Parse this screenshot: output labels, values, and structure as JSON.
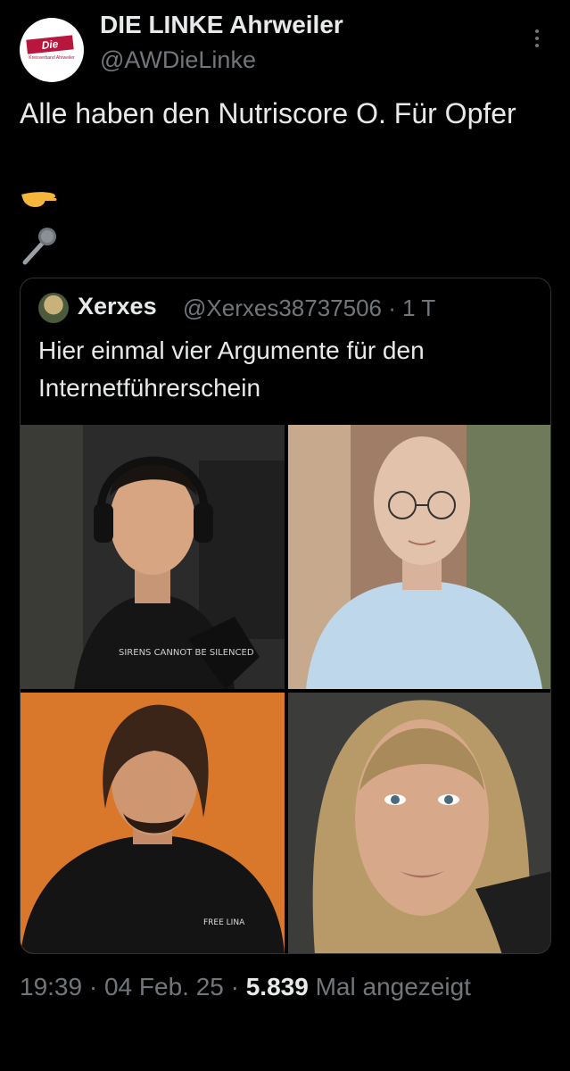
{
  "author": {
    "name": "DIE LINKE Ahrweiler",
    "handle": "@AWDieLinke",
    "avatar_logo": "Die Linke",
    "avatar_sub": "Kreisverband Ahrweiler"
  },
  "tweet": {
    "text": "Alle haben den Nutriscore O. Für Opfer",
    "emojis": [
      "pointing-hand-icon",
      "microphone-icon"
    ]
  },
  "quote": {
    "name": "Xerxes",
    "handle_meta": "@Xerxes38737506 · 1 T",
    "text": "Hier einmal vier Argumente für den Internetführerschein",
    "photos": [
      {
        "label": "woman-with-headset-photo",
        "shirt_text": "SIRENS CANNOT BE SILENCED"
      },
      {
        "label": "bald-man-with-glasses-photo"
      },
      {
        "label": "man-with-long-hair-photo",
        "shirt_text": "FREE LINA"
      },
      {
        "label": "blonde-woman-portrait-photo"
      }
    ]
  },
  "meta": {
    "time": "19:39",
    "date": "04 Feb. 25",
    "views": "5.839",
    "views_label": "Mal angezeigt",
    "separator": "·"
  },
  "colors": {
    "background": "#000000",
    "text_primary": "#e7e9ea",
    "text_secondary": "#71767b",
    "brand_red": "#b8163c"
  }
}
